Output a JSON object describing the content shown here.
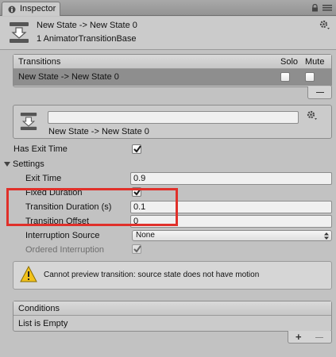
{
  "tab": {
    "title": "Inspector"
  },
  "header": {
    "title": "New State -> New State 0",
    "subtitle": "1 AnimatorTransitionBase"
  },
  "transitions": {
    "columns": [
      "Transitions",
      "Solo",
      "Mute"
    ],
    "rows": [
      {
        "name": "New State -> New State 0",
        "solo": false,
        "mute": false
      }
    ],
    "remove_label": "—"
  },
  "transition": {
    "name_field_value": "",
    "subtitle": "New State -> New State 0"
  },
  "has_exit_time": {
    "label": "Has Exit Time",
    "checked": true
  },
  "settings": {
    "label": "Settings",
    "exit_time": {
      "label": "Exit Time",
      "value": "0.9"
    },
    "fixed_duration": {
      "label": "Fixed Duration",
      "checked": true
    },
    "transition_duration": {
      "label": "Transition Duration (s)",
      "value": "0.1"
    },
    "transition_offset": {
      "label": "Transition Offset",
      "value": "0"
    },
    "interruption_source": {
      "label": "Interruption Source",
      "value": "None"
    },
    "ordered_interruption": {
      "label": "Ordered Interruption",
      "checked": true
    }
  },
  "warning": {
    "text": "Cannot preview transition: source state does not have motion"
  },
  "conditions": {
    "title": "Conditions",
    "empty_text": "List is Empty",
    "add_label": "+",
    "remove_label": "—"
  },
  "colors": {
    "highlight": "#e0302a",
    "selection": "#8e8e8e",
    "panel_bg": "#c2c2c2"
  }
}
